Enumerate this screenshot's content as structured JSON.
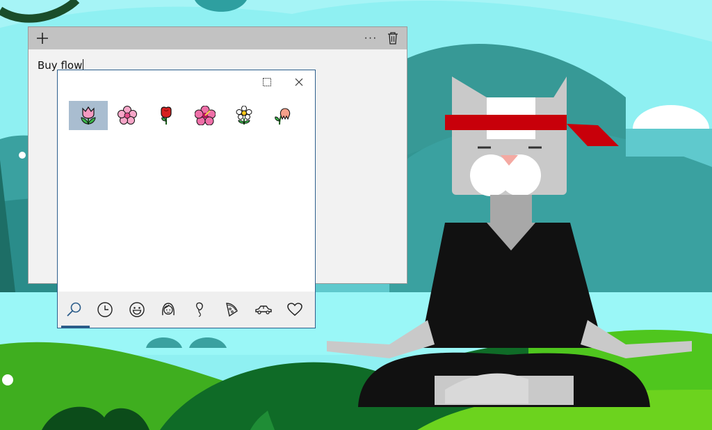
{
  "note": {
    "text": "Buy flow",
    "toolbar": {
      "add_icon": "plus-icon",
      "more_icon": "ellipsis-icon",
      "more_label": "···",
      "delete_icon": "trash-icon"
    }
  },
  "emoji_panel": {
    "controls": [
      "dock-icon",
      "close-icon"
    ],
    "results": [
      {
        "name": "tulip",
        "selected": true
      },
      {
        "name": "cherry-blossom",
        "selected": false
      },
      {
        "name": "rose",
        "selected": false
      },
      {
        "name": "hibiscus",
        "selected": false
      },
      {
        "name": "blossom",
        "selected": false
      },
      {
        "name": "wilted-flower",
        "selected": false
      }
    ],
    "categories": [
      {
        "icon": "search-icon",
        "active": true
      },
      {
        "icon": "clock-icon",
        "active": false
      },
      {
        "icon": "smiley-icon",
        "active": false
      },
      {
        "icon": "person-icon",
        "active": false
      },
      {
        "icon": "balloon-icon",
        "active": false
      },
      {
        "icon": "pizza-icon",
        "active": false
      },
      {
        "icon": "car-icon",
        "active": false
      },
      {
        "icon": "heart-icon",
        "active": false
      }
    ]
  },
  "colors": {
    "panel_border": "#2c5e8c",
    "selection": "#a9bdd0",
    "active_tab": "#2b5c89",
    "note_bar": "#c2c2c2"
  }
}
